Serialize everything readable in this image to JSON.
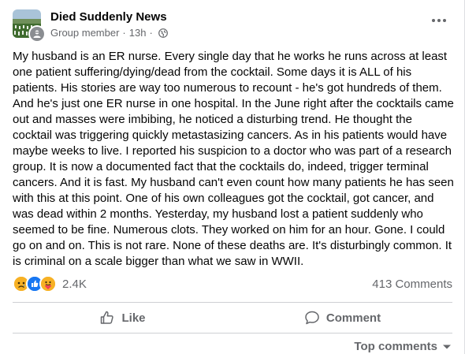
{
  "post": {
    "group_name": "Died Suddenly News",
    "role": "Group member",
    "separator": "·",
    "time": "13h",
    "privacy_icon": "globe-icon",
    "more_icon": "more-options-icon",
    "body": "My husband is an ER nurse.  Every single day that he works he runs across at least one patient suffering/dying/dead from the cocktail. Some days it is ALL of his patients.  His stories are way too numerous to recount - he's got hundreds of them.  And he's just one ER nurse in one hospital.  In  the June right after the cocktails came out and masses were imbibing, he noticed a disturbing trend.  He thought the cocktail was triggering quickly metastasizing cancers.  As in his patients would have maybe weeks to live.  I reported his suspicion to a doctor who was part of a research group.  It is now a documented fact that the cocktails do, indeed, trigger terminal cancers.  And it is fast.  My husband can't even count how many patients he has seen with this at this point.  One of his own colleagues got the cocktail, got cancer, and was dead within 2 months. Yesterday, my husband lost a patient suddenly who seemed to be fine.  Numerous clots.  They worked on him for an hour.  Gone. I could go on and on.  This is not rare.  None of these deaths are.  It's disturbingly common.  It is criminal on a scale bigger than what we saw in WWII."
  },
  "stats": {
    "reactions": [
      "sad-reaction-icon",
      "like-reaction-icon",
      "care-reaction-icon"
    ],
    "reaction_count": "2.4K",
    "comment_count": "413 Comments"
  },
  "actions": {
    "like_label": "Like",
    "comment_label": "Comment"
  },
  "footer": {
    "top_comments_label": "Top comments"
  },
  "colors": {
    "text": "#050505",
    "secondary": "#65676b",
    "like_blue": "#1877f2",
    "sad_yellow": "#f7b125"
  }
}
